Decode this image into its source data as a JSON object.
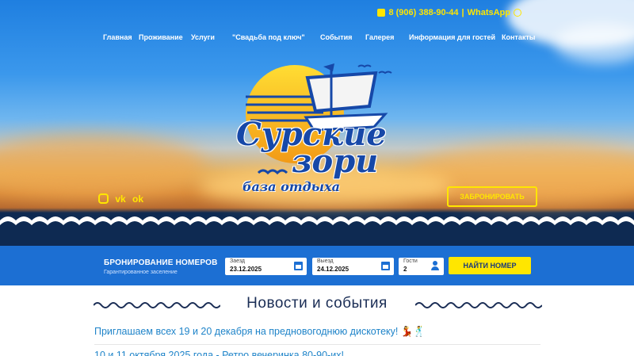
{
  "header": {
    "phone": "8 (906) 388-90-44",
    "separator": "|",
    "whatsapp": "WhatsApp"
  },
  "nav": {
    "items": [
      {
        "label": "Главная"
      },
      {
        "label": "Проживание"
      },
      {
        "label": "Услуги"
      },
      {
        "label": "\"Свадьба под ключ\""
      },
      {
        "label": "События"
      },
      {
        "label": "Галерея"
      },
      {
        "label": "Информация для гостей"
      },
      {
        "label": "Контакты"
      }
    ]
  },
  "logo": {
    "line1": "Сурские",
    "line2": "зори",
    "line3": "база отдыха"
  },
  "social": {
    "vk": "vk",
    "ok": "ok"
  },
  "hero": {
    "book_button": "ЗАБРОНИРОВАТЬ"
  },
  "booking": {
    "title": "БРОНИРОВАНИЕ НОМЕРОВ",
    "subtitle": "Гарантированное заселение",
    "checkin_label": "Заезд",
    "checkin_value": "23.12.2025",
    "checkout_label": "Выезд",
    "checkout_value": "24.12.2025",
    "guests_label": "Гости",
    "guests_value": "2",
    "find_button": "НАЙТИ НОМЕР"
  },
  "news": {
    "heading": "Новости и события",
    "items": [
      {
        "title": "Приглашаем всех 19 и 20 декабря на предновогоднюю дискотеку! 💃🕺"
      },
      {
        "title": "10 и 11 октября 2025 года - Ретро вечеринка 80-90-их!"
      }
    ]
  },
  "colors": {
    "accent": "#ffe600",
    "brand_blue": "#1c6fd3",
    "link": "#1f84c9",
    "logo_blue": "#1648a8"
  }
}
